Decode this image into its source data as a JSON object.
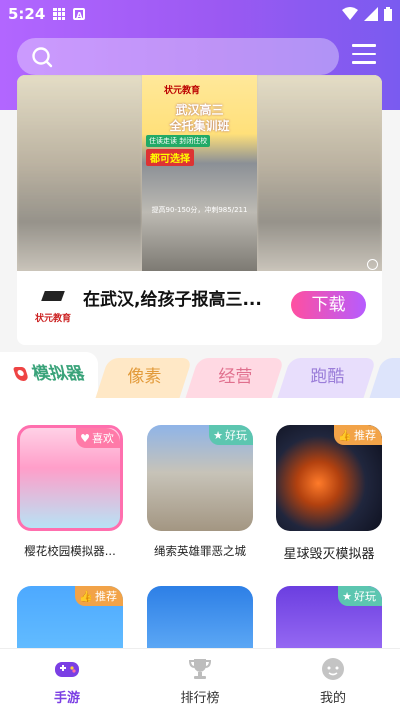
{
  "status_bar": {
    "time": "5:24"
  },
  "search": {
    "placeholder": ""
  },
  "ad": {
    "brand": "状元教育",
    "headline_1": "武汉高三",
    "headline_2": "全托集训班",
    "tag_1": "住读走读 封闭住校",
    "tag_2": "都可选择",
    "footer": "提高90-150分，冲刺985/211",
    "title": "在武汉,给孩子报高三...",
    "logo_text": "状元教育",
    "download_label": "下载"
  },
  "tabs": [
    {
      "label": "模拟器",
      "active": true
    },
    {
      "label": "像素"
    },
    {
      "label": "经营"
    },
    {
      "label": "跑酷"
    }
  ],
  "apps": [
    {
      "name": "樱花校园模拟器...",
      "badge": "喜欢",
      "badge_icon": "heart-icon",
      "badge_color": "#ff7aa8"
    },
    {
      "name": "绳索英雄罪恶之城",
      "badge": "好玩",
      "badge_icon": "star-icon",
      "badge_color": "#5cc6b0"
    },
    {
      "name": "星球毁灭模拟器",
      "badge": "推荐",
      "badge_icon": "thumb-up-icon",
      "badge_color": "#f2a348"
    },
    {
      "name": "",
      "badge": "推荐",
      "badge_icon": "thumb-up-icon",
      "badge_color": "#f2a348"
    },
    {
      "name": "",
      "badge": "",
      "badge_icon": "",
      "badge_color": ""
    },
    {
      "name": "",
      "badge": "好玩",
      "badge_icon": "star-icon",
      "badge_color": "#5cc6b0"
    }
  ],
  "nav": {
    "home": "手游",
    "ranking": "排行榜",
    "mine": "我的"
  },
  "colors": {
    "accent": "#7b3fe4",
    "header_start": "#b266ff",
    "header_end": "#7a5bf0"
  }
}
